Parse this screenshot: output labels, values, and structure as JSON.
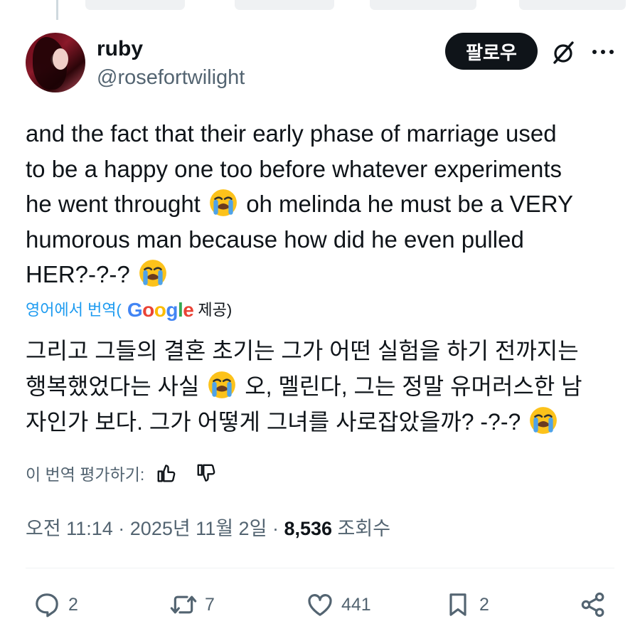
{
  "author": {
    "display_name": "ruby",
    "handle": "@rosefortwilight"
  },
  "header": {
    "follow_label": "팔로우",
    "grok_icon": "grok-slash-icon",
    "more_icon": "more-dots-icon"
  },
  "tweet": {
    "line1": "and the fact that their early phase of marriage used",
    "line2": "to be a happy one too before whatever experiments",
    "line3a": "he went throught",
    "line3b": "oh melinda he must be a VERY",
    "line4": "humorous man because how did he even pulled",
    "line5": "HER?-?-?",
    "emoji_name": "loudly-crying-face"
  },
  "translation": {
    "label_prefix": "영어에서 번역(",
    "provider": [
      "G",
      "o",
      "o",
      "g",
      "l",
      "e"
    ],
    "label_suffix": "제공)",
    "line1": "그리고 그들의 결혼 초기는 그가 어떤 실험을 하기 전까지는",
    "line2a": "행복했었다는 사실",
    "line2b": "오, 멜린다, 그는 정말 유머러스한 남",
    "line3": "자인가 보다. 그가 어떻게 그녀를 사로잡았을까? -?-?",
    "rate_label": "이 번역 평가하기:"
  },
  "meta": {
    "time": "오전 11:14",
    "date": "2025년 11월 2일",
    "separator": "·",
    "views_count": "8,536",
    "views_label": "조회수"
  },
  "actions": {
    "replies": "2",
    "reposts": "7",
    "likes": "441",
    "bookmarks": "2"
  },
  "colors": {
    "accent": "#1d9bf0",
    "text": "#0f1419",
    "secondary": "#536471",
    "follow_bg": "#0f1419"
  }
}
